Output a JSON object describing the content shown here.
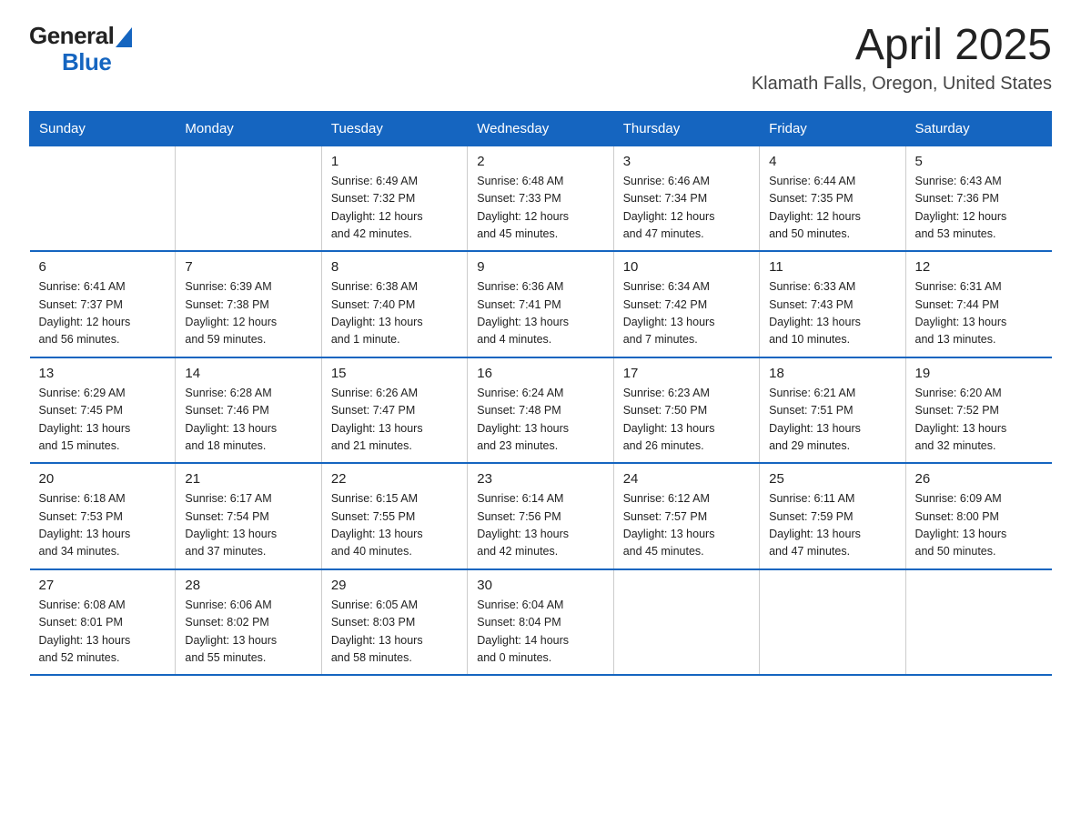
{
  "logo": {
    "text_general": "General",
    "text_blue": "Blue",
    "aria": "GeneralBlue logo"
  },
  "title": "April 2025",
  "subtitle": "Klamath Falls, Oregon, United States",
  "days_of_week": [
    "Sunday",
    "Monday",
    "Tuesday",
    "Wednesday",
    "Thursday",
    "Friday",
    "Saturday"
  ],
  "weeks": [
    [
      {
        "day": "",
        "info": ""
      },
      {
        "day": "",
        "info": ""
      },
      {
        "day": "1",
        "info": "Sunrise: 6:49 AM\nSunset: 7:32 PM\nDaylight: 12 hours\nand 42 minutes."
      },
      {
        "day": "2",
        "info": "Sunrise: 6:48 AM\nSunset: 7:33 PM\nDaylight: 12 hours\nand 45 minutes."
      },
      {
        "day": "3",
        "info": "Sunrise: 6:46 AM\nSunset: 7:34 PM\nDaylight: 12 hours\nand 47 minutes."
      },
      {
        "day": "4",
        "info": "Sunrise: 6:44 AM\nSunset: 7:35 PM\nDaylight: 12 hours\nand 50 minutes."
      },
      {
        "day": "5",
        "info": "Sunrise: 6:43 AM\nSunset: 7:36 PM\nDaylight: 12 hours\nand 53 minutes."
      }
    ],
    [
      {
        "day": "6",
        "info": "Sunrise: 6:41 AM\nSunset: 7:37 PM\nDaylight: 12 hours\nand 56 minutes."
      },
      {
        "day": "7",
        "info": "Sunrise: 6:39 AM\nSunset: 7:38 PM\nDaylight: 12 hours\nand 59 minutes."
      },
      {
        "day": "8",
        "info": "Sunrise: 6:38 AM\nSunset: 7:40 PM\nDaylight: 13 hours\nand 1 minute."
      },
      {
        "day": "9",
        "info": "Sunrise: 6:36 AM\nSunset: 7:41 PM\nDaylight: 13 hours\nand 4 minutes."
      },
      {
        "day": "10",
        "info": "Sunrise: 6:34 AM\nSunset: 7:42 PM\nDaylight: 13 hours\nand 7 minutes."
      },
      {
        "day": "11",
        "info": "Sunrise: 6:33 AM\nSunset: 7:43 PM\nDaylight: 13 hours\nand 10 minutes."
      },
      {
        "day": "12",
        "info": "Sunrise: 6:31 AM\nSunset: 7:44 PM\nDaylight: 13 hours\nand 13 minutes."
      }
    ],
    [
      {
        "day": "13",
        "info": "Sunrise: 6:29 AM\nSunset: 7:45 PM\nDaylight: 13 hours\nand 15 minutes."
      },
      {
        "day": "14",
        "info": "Sunrise: 6:28 AM\nSunset: 7:46 PM\nDaylight: 13 hours\nand 18 minutes."
      },
      {
        "day": "15",
        "info": "Sunrise: 6:26 AM\nSunset: 7:47 PM\nDaylight: 13 hours\nand 21 minutes."
      },
      {
        "day": "16",
        "info": "Sunrise: 6:24 AM\nSunset: 7:48 PM\nDaylight: 13 hours\nand 23 minutes."
      },
      {
        "day": "17",
        "info": "Sunrise: 6:23 AM\nSunset: 7:50 PM\nDaylight: 13 hours\nand 26 minutes."
      },
      {
        "day": "18",
        "info": "Sunrise: 6:21 AM\nSunset: 7:51 PM\nDaylight: 13 hours\nand 29 minutes."
      },
      {
        "day": "19",
        "info": "Sunrise: 6:20 AM\nSunset: 7:52 PM\nDaylight: 13 hours\nand 32 minutes."
      }
    ],
    [
      {
        "day": "20",
        "info": "Sunrise: 6:18 AM\nSunset: 7:53 PM\nDaylight: 13 hours\nand 34 minutes."
      },
      {
        "day": "21",
        "info": "Sunrise: 6:17 AM\nSunset: 7:54 PM\nDaylight: 13 hours\nand 37 minutes."
      },
      {
        "day": "22",
        "info": "Sunrise: 6:15 AM\nSunset: 7:55 PM\nDaylight: 13 hours\nand 40 minutes."
      },
      {
        "day": "23",
        "info": "Sunrise: 6:14 AM\nSunset: 7:56 PM\nDaylight: 13 hours\nand 42 minutes."
      },
      {
        "day": "24",
        "info": "Sunrise: 6:12 AM\nSunset: 7:57 PM\nDaylight: 13 hours\nand 45 minutes."
      },
      {
        "day": "25",
        "info": "Sunrise: 6:11 AM\nSunset: 7:59 PM\nDaylight: 13 hours\nand 47 minutes."
      },
      {
        "day": "26",
        "info": "Sunrise: 6:09 AM\nSunset: 8:00 PM\nDaylight: 13 hours\nand 50 minutes."
      }
    ],
    [
      {
        "day": "27",
        "info": "Sunrise: 6:08 AM\nSunset: 8:01 PM\nDaylight: 13 hours\nand 52 minutes."
      },
      {
        "day": "28",
        "info": "Sunrise: 6:06 AM\nSunset: 8:02 PM\nDaylight: 13 hours\nand 55 minutes."
      },
      {
        "day": "29",
        "info": "Sunrise: 6:05 AM\nSunset: 8:03 PM\nDaylight: 13 hours\nand 58 minutes."
      },
      {
        "day": "30",
        "info": "Sunrise: 6:04 AM\nSunset: 8:04 PM\nDaylight: 14 hours\nand 0 minutes."
      },
      {
        "day": "",
        "info": ""
      },
      {
        "day": "",
        "info": ""
      },
      {
        "day": "",
        "info": ""
      }
    ]
  ]
}
